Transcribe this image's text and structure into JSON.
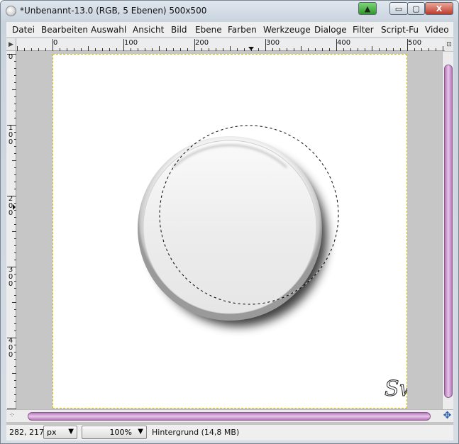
{
  "window": {
    "title": "*Unbenannt-13.0 (RGB, 5 Ebenen) 500x500",
    "close_glyph": "X",
    "min_glyph": "▭",
    "max_glyph": "▢",
    "extra_glyph": "▲"
  },
  "menu": {
    "items": [
      "Datei",
      "Bearbeiten",
      "Auswahl",
      "Ansicht",
      "Bild",
      "Ebene",
      "Farben",
      "Werkzeuge",
      "Dialoge",
      "Filter",
      "Script-Fu",
      "Video"
    ]
  },
  "rulers": {
    "horizontal_labels": [
      "0",
      "100",
      "200",
      "300",
      "400",
      "500"
    ],
    "vertical_labels": [
      "0",
      "100",
      "200",
      "300",
      "400"
    ]
  },
  "canvas": {
    "signature": "Sw",
    "accent_color": "#d4c400"
  },
  "statusbar": {
    "coords": "282, 217",
    "unit": "px",
    "zoom": "100%",
    "layer_info": "Hintergrund (14,8 MB)"
  },
  "icons": {
    "app": "gimp-icon",
    "nav": "navigate-icon",
    "move": "move-cross-icon"
  }
}
